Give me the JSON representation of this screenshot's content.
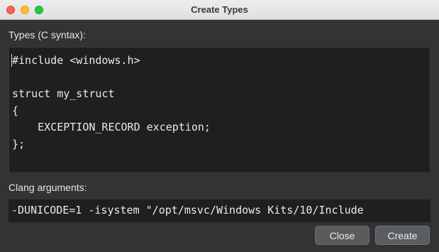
{
  "window": {
    "title": "Create Types"
  },
  "types_section": {
    "label": "Types (C syntax):",
    "code": "#include <windows.h>\n\nstruct my_struct\n{\n    EXCEPTION_RECORD exception;\n};"
  },
  "clang_section": {
    "label": "Clang arguments:",
    "value": "-DUNICODE=1 -isystem \"/opt/msvc/Windows Kits/10/Include"
  },
  "buttons": {
    "close_label": "Close",
    "create_label": "Create"
  }
}
